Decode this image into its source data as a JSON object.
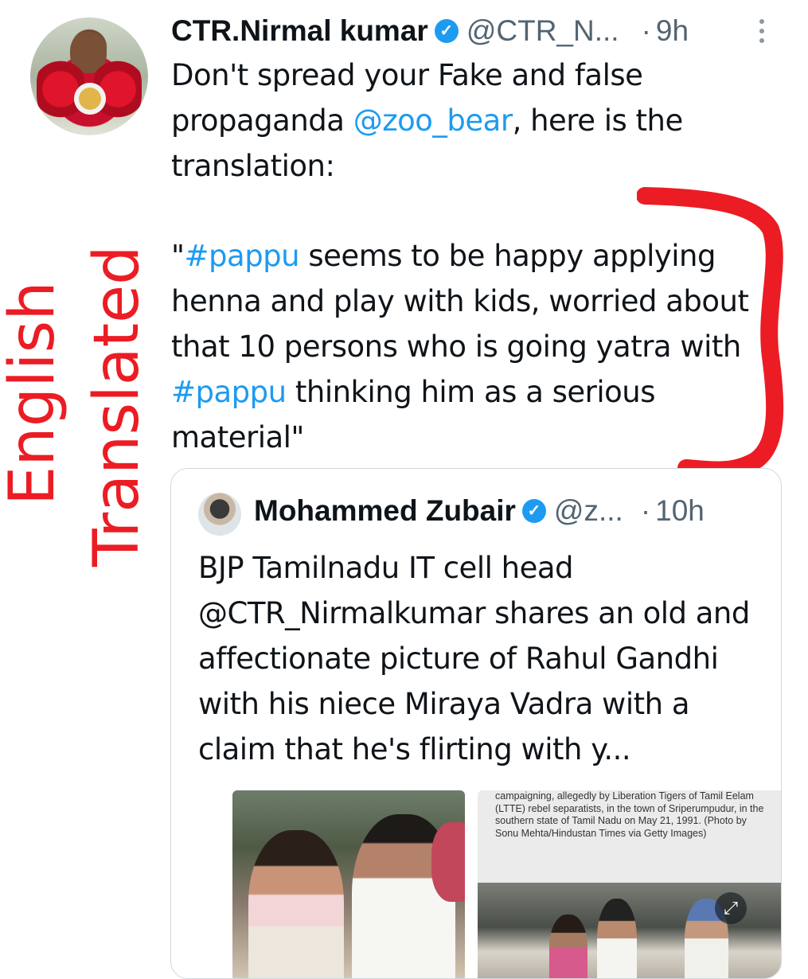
{
  "tweet": {
    "author_name": "CTR.Nirmal kumar",
    "handle": "@CTR_N...",
    "time": "9h",
    "separator": "·",
    "paragraph1": [
      {
        "text": "Don't spread your Fake and false propaganda ",
        "link": false
      },
      {
        "text": "@zoo_bear",
        "link": true
      },
      {
        "text": ", here is the translation:",
        "link": false
      }
    ],
    "paragraph2": [
      {
        "text": "\"",
        "link": false
      },
      {
        "text": "#pappu",
        "link": true
      },
      {
        "text": " seems to be happy applying henna and play with kids, worried about that 10 persons who is going yatra with ",
        "link": false
      },
      {
        "text": "#pappu",
        "link": true
      },
      {
        "text": " thinking him as a serious material\"",
        "link": false
      }
    ]
  },
  "annotation": {
    "line1": "English",
    "line2": "Translated",
    "color": "#ec1c24"
  },
  "quoted_tweet": {
    "author_name": "Mohammed Zubair",
    "handle": "@z...",
    "time": "10h",
    "separator": "·",
    "text": "BJP Tamilnadu IT cell head @CTR_Nirmalkumar shares an old and affectionate picture of Rahul Gandhi with his niece Miraya Vadra with a claim that he's flirting with y...",
    "media_caption": "campaigning, allegedly by Liberation Tigers of Tamil Eelam (LTTE) rebel separatists, in the town of Sriperumpudur, in the southern state of Tamil Nadu on May 21, 1991. (Photo by Sonu Mehta/Hindustan Times via Getty Images)"
  },
  "icons": {
    "verified": "verified-badge-icon",
    "more": "more-vertical-icon",
    "expand": "expand-icon"
  },
  "colors": {
    "link": "#1d9bf0",
    "secondary_text": "#536471",
    "annotation_red": "#ec1c24"
  }
}
